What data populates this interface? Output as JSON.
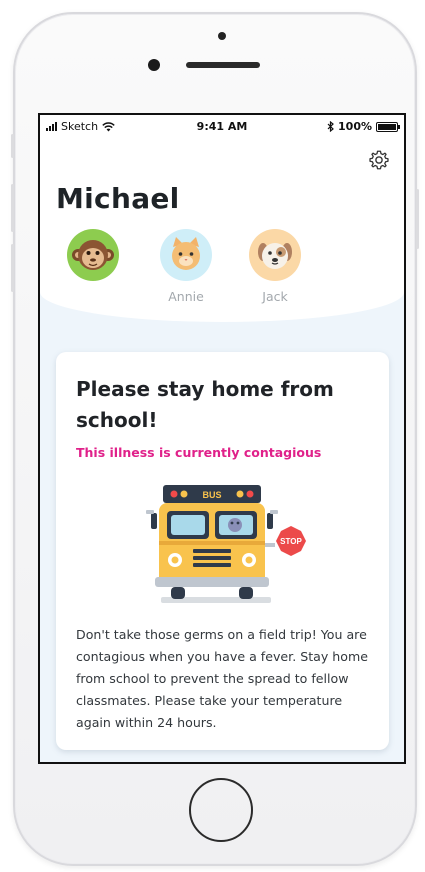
{
  "status_bar": {
    "carrier": "Sketch",
    "time": "9:41 AM",
    "battery": "100%"
  },
  "profile": {
    "name": "Michael"
  },
  "children": [
    {
      "label": "",
      "icon": "monkey-icon",
      "selected": true
    },
    {
      "label": "Annie",
      "icon": "cat-icon",
      "selected": false
    },
    {
      "label": "Jack",
      "icon": "dog-icon",
      "selected": false
    }
  ],
  "card": {
    "title": "Please stay home from school!",
    "warning": "This illness is currently contagious",
    "bus_label": "BUS",
    "stop_label": "STOP",
    "body": "Don't take those germs on a field trip! You are contagious when you have a fever. Stay home from school to prevent the spread to fellow classmates. Please take your temperature again within 24 hours."
  },
  "colors": {
    "accent": "#e0218a",
    "selected_avatar": "#8dcc4f",
    "bus": "#f9c34d",
    "stop": "#ec4a4a"
  }
}
